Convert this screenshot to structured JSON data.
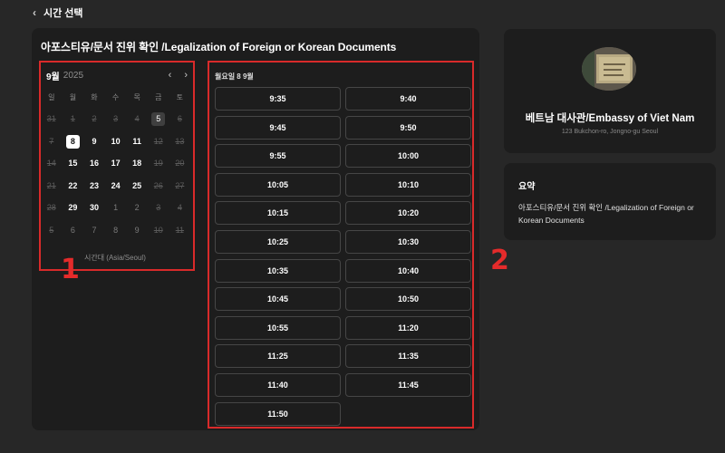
{
  "header": {
    "back_label": "시간 선택",
    "back_icon": "chevron-left-icon"
  },
  "main": {
    "title": "아포스티유/문서 진위 확인 /Legalization of Foreign or Korean Documents"
  },
  "calendar": {
    "month": "9월",
    "year": "2025",
    "prev_icon": "chevron-left-icon",
    "next_icon": "chevron-right-icon",
    "weekdays": [
      "일",
      "월",
      "화",
      "수",
      "목",
      "금",
      "토"
    ],
    "weeks": [
      [
        {
          "d": "31",
          "s": "off"
        },
        {
          "d": "1",
          "s": "off"
        },
        {
          "d": "2",
          "s": "off"
        },
        {
          "d": "3",
          "s": "off"
        },
        {
          "d": "4",
          "s": "off"
        },
        {
          "d": "5",
          "s": "today"
        },
        {
          "d": "6",
          "s": "off"
        }
      ],
      [
        {
          "d": "7",
          "s": "off"
        },
        {
          "d": "8",
          "s": "sel"
        },
        {
          "d": "9",
          "s": "avail"
        },
        {
          "d": "10",
          "s": "avail"
        },
        {
          "d": "11",
          "s": "avail"
        },
        {
          "d": "12",
          "s": "off"
        },
        {
          "d": "13",
          "s": "off"
        }
      ],
      [
        {
          "d": "14",
          "s": "off"
        },
        {
          "d": "15",
          "s": "avail"
        },
        {
          "d": "16",
          "s": "avail"
        },
        {
          "d": "17",
          "s": "avail"
        },
        {
          "d": "18",
          "s": "avail"
        },
        {
          "d": "19",
          "s": "off"
        },
        {
          "d": "20",
          "s": "off"
        }
      ],
      [
        {
          "d": "21",
          "s": "off"
        },
        {
          "d": "22",
          "s": "avail"
        },
        {
          "d": "23",
          "s": "avail"
        },
        {
          "d": "24",
          "s": "avail"
        },
        {
          "d": "25",
          "s": "avail"
        },
        {
          "d": "26",
          "s": "off"
        },
        {
          "d": "27",
          "s": "off"
        }
      ],
      [
        {
          "d": "28",
          "s": "off"
        },
        {
          "d": "29",
          "s": "avail"
        },
        {
          "d": "30",
          "s": "avail"
        },
        {
          "d": "1",
          "s": "other"
        },
        {
          "d": "2",
          "s": "other"
        },
        {
          "d": "3",
          "s": "off"
        },
        {
          "d": "4",
          "s": "off"
        }
      ],
      [
        {
          "d": "5",
          "s": "off"
        },
        {
          "d": "6",
          "s": "other"
        },
        {
          "d": "7",
          "s": "other"
        },
        {
          "d": "8",
          "s": "other"
        },
        {
          "d": "9",
          "s": "other"
        },
        {
          "d": "10",
          "s": "off"
        },
        {
          "d": "11",
          "s": "off"
        }
      ]
    ],
    "timezone": "시간대 (Asia/Seoul)"
  },
  "slots": {
    "date_label": "월요일 8 9월",
    "times": [
      "9:35",
      "9:40",
      "9:45",
      "9:50",
      "9:55",
      "10:00",
      "10:05",
      "10:10",
      "10:15",
      "10:20",
      "10:25",
      "10:30",
      "10:35",
      "10:40",
      "10:45",
      "10:50",
      "10:55",
      "11:20",
      "11:25",
      "11:35",
      "11:40",
      "11:45",
      "11:50"
    ]
  },
  "embassy": {
    "name": "베트남 대사관/Embassy of Viet Nam",
    "address": "123 Bukchon-ro, Jongno-gu Seoul"
  },
  "summary": {
    "heading": "요약",
    "text": "아포스티유/문서 진위 확인 /Legalization of Foreign or Korean Documents"
  },
  "markers": {
    "one": "1",
    "two": "2"
  },
  "colors": {
    "background": "#272727",
    "panel": "#1d1d1d",
    "highlight": "#d92a2a",
    "selected": "#ffffff"
  }
}
